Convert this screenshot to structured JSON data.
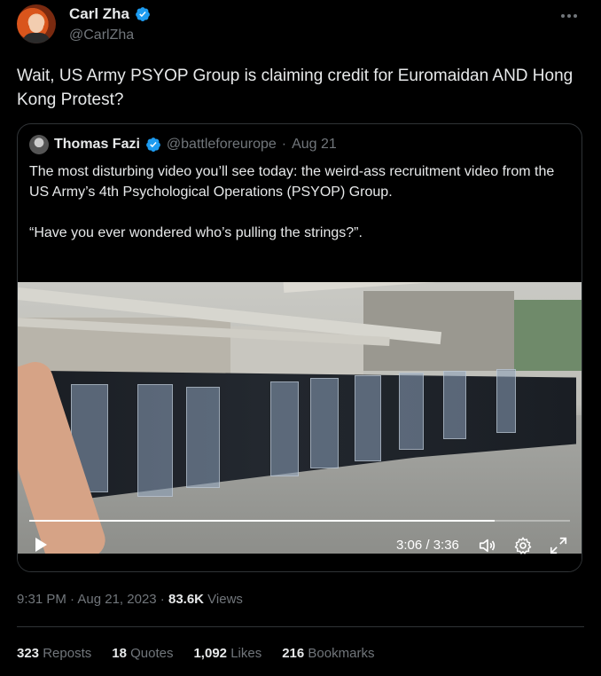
{
  "author": {
    "display_name": "Carl Zha",
    "handle": "@CarlZha",
    "verified": true
  },
  "tweet": {
    "text": "Wait, US Army PSYOP Group is claiming credit for Euromaidan AND Hong Kong Protest?"
  },
  "quote": {
    "display_name": "Thomas Fazi",
    "handle": "@battleforeurope",
    "separator": "·",
    "date": "Aug 21",
    "paragraph_1": "The most disturbing video you’ll see today: the weird-ass recruitment video from the US Army’s 4th Psychological Operations (PSYOP) Group.",
    "paragraph_2": "“Have you ever wondered who’s pulling the strings?”."
  },
  "video": {
    "time": "3:06 / 3:36",
    "progress": 0.861
  },
  "meta": {
    "time": "9:31 PM",
    "sep1": " · ",
    "date": "Aug 21, 2023",
    "sep2": " · ",
    "views_count": "83.6K",
    "views_label": " Views"
  },
  "stats": [
    {
      "count": "323",
      "label": "Reposts"
    },
    {
      "count": "18",
      "label": "Quotes"
    },
    {
      "count": "1,092",
      "label": "Likes"
    },
    {
      "count": "216",
      "label": "Bookmarks"
    }
  ],
  "colors": {
    "background": "#000000",
    "text": "#e7e9ea",
    "secondary": "#71767b",
    "border": "#2f3336",
    "verified": "#1d9bf0"
  }
}
